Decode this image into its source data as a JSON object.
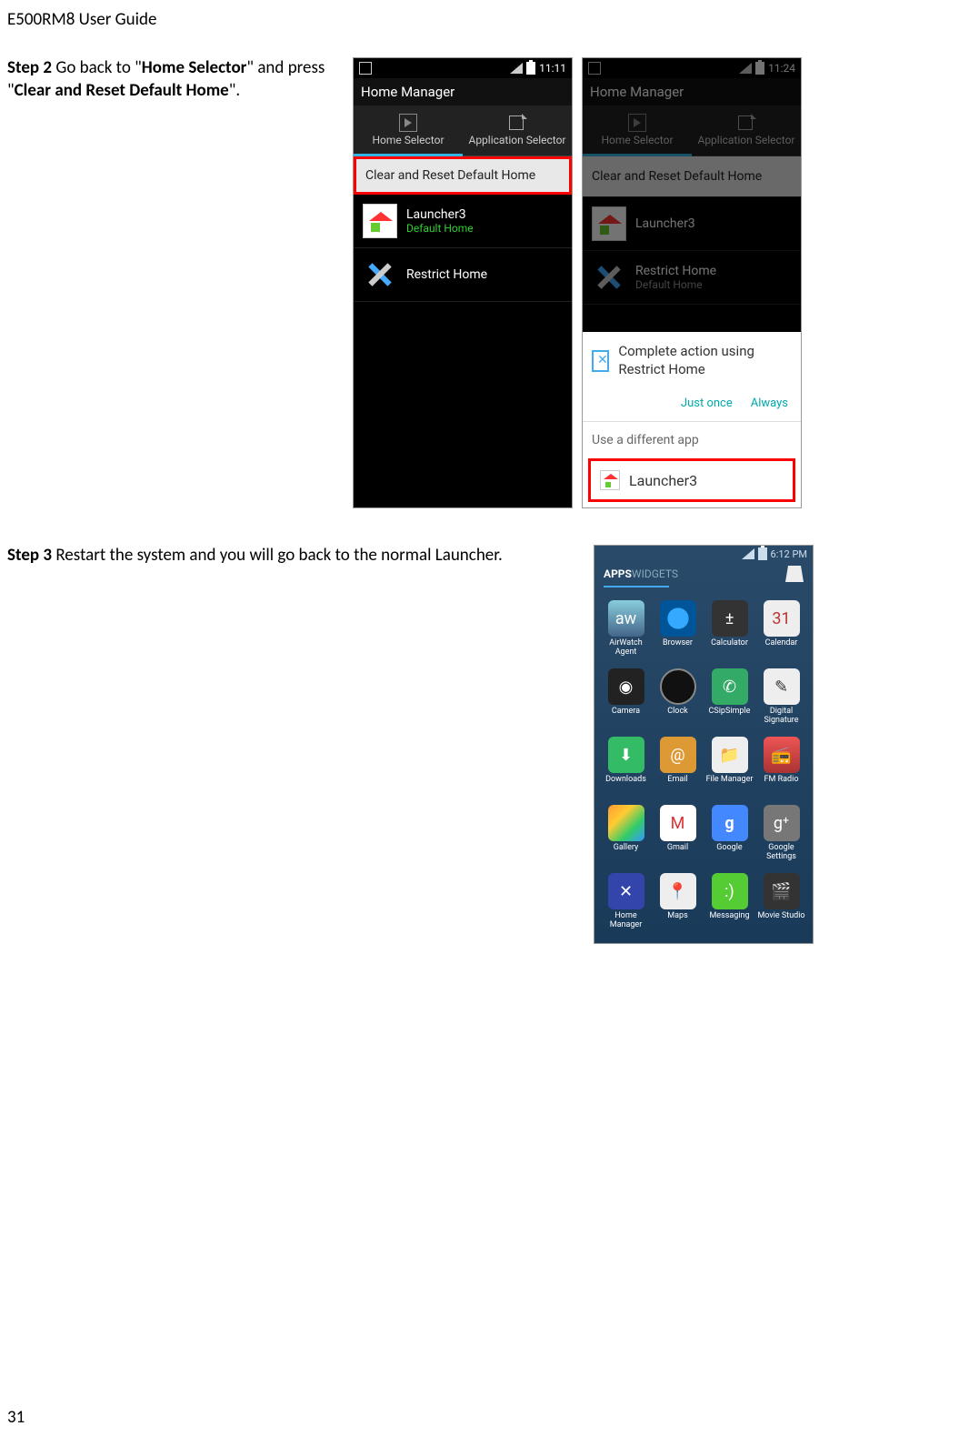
{
  "header": "E500RM8 User Guide",
  "step2": {
    "label": "Step 2",
    "text_before": " Go back to \"",
    "bold1": "Home Selector",
    "text_mid": "\" and press \"",
    "bold2": "Clear and Reset Default Home",
    "text_after": "\"."
  },
  "step3": {
    "label": "Step 3",
    "text": " Restart the system and you will go back to the normal Launcher."
  },
  "phone1": {
    "time": "11:11",
    "appTitle": "Home Manager",
    "tab1": "Home Selector",
    "tab2": "Application Selector",
    "clearReset": "Clear and Reset Default Home",
    "launcher3": "Launcher3",
    "defaultHome": "Default Home",
    "restrictHome": "Restrict Home"
  },
  "phone2": {
    "time": "11:24",
    "appTitle": "Home Manager",
    "tab1": "Home Selector",
    "tab2": "Application Selector",
    "clearReset": "Clear and Reset Default Home",
    "launcher3": "Launcher3",
    "restrictHome": "Restrict Home",
    "defaultHome": "Default Home",
    "dialogText": "Complete action using Restrict Home",
    "justOnce": "Just once",
    "always": "Always",
    "useDifferent": "Use a different app",
    "optionLauncher3": "Launcher3"
  },
  "launcher": {
    "time": "6:12 PM",
    "tabApps": "APPS",
    "tabWidgets": "WIDGETS",
    "apps": [
      {
        "label": "AirWatch Agent",
        "cls": "ic-aw",
        "glyph": "aw"
      },
      {
        "label": "Browser",
        "cls": "ic-browser",
        "glyph": ""
      },
      {
        "label": "Calculator",
        "cls": "ic-calc",
        "glyph": "±"
      },
      {
        "label": "Calendar",
        "cls": "ic-calendar",
        "glyph": "31"
      },
      {
        "label": "Camera",
        "cls": "ic-camera",
        "glyph": "◉"
      },
      {
        "label": "Clock",
        "cls": "ic-clock",
        "glyph": ""
      },
      {
        "label": "CSipSimple",
        "cls": "ic-csip",
        "glyph": "✆"
      },
      {
        "label": "Digital Signature",
        "cls": "ic-sig",
        "glyph": "✎"
      },
      {
        "label": "Downloads",
        "cls": "ic-download",
        "glyph": "⬇"
      },
      {
        "label": "Email",
        "cls": "ic-email",
        "glyph": "@"
      },
      {
        "label": "File Manager",
        "cls": "ic-file",
        "glyph": "📁"
      },
      {
        "label": "FM Radio",
        "cls": "ic-fm",
        "glyph": "📻"
      },
      {
        "label": "Gallery",
        "cls": "ic-gallery",
        "glyph": ""
      },
      {
        "label": "Gmail",
        "cls": "ic-gmail",
        "glyph": "M"
      },
      {
        "label": "Google",
        "cls": "ic-google",
        "glyph": "g"
      },
      {
        "label": "Google Settings",
        "cls": "ic-gsettings",
        "glyph": "g⁺"
      },
      {
        "label": "Home Manager",
        "cls": "ic-home",
        "glyph": "✕"
      },
      {
        "label": "Maps",
        "cls": "ic-maps",
        "glyph": "📍"
      },
      {
        "label": "Messaging",
        "cls": "ic-msg",
        "glyph": ":)"
      },
      {
        "label": "Movie Studio",
        "cls": "ic-movie",
        "glyph": "🎬"
      }
    ]
  },
  "pageNumber": "31"
}
